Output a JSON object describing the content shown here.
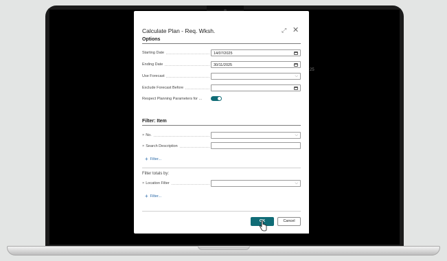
{
  "dialog": {
    "title": "Calculate Plan - Req. Wksh."
  },
  "options": {
    "heading": "Options",
    "starting_date_label": "Starting Date",
    "starting_date_value": "14/07/2025",
    "ending_date_label": "Ending Date",
    "ending_date_value": "30/11/2025",
    "use_forecast_label": "Use Forecast",
    "use_forecast_value": "",
    "exclude_forecast_label": "Exclude Forecast Before",
    "exclude_forecast_value": "",
    "respect_params_label": "Respect Planning Parameters for ...",
    "respect_params_on": true
  },
  "filter_item": {
    "heading": "Filter: Item",
    "no_label": "No.",
    "no_value": "",
    "search_desc_label": "Search Description",
    "search_desc_value": "",
    "add_filter": "Filter..."
  },
  "filter_totals": {
    "heading": "Filter totals by:",
    "location_label": "Location Filter",
    "location_value": "",
    "add_filter": "Filter..."
  },
  "actions": {
    "ok": "OK",
    "cancel": "Cancel"
  },
  "background": {
    "hint_text": "25"
  },
  "colors": {
    "accent": "#106c76",
    "link": "#2a6aa8"
  }
}
